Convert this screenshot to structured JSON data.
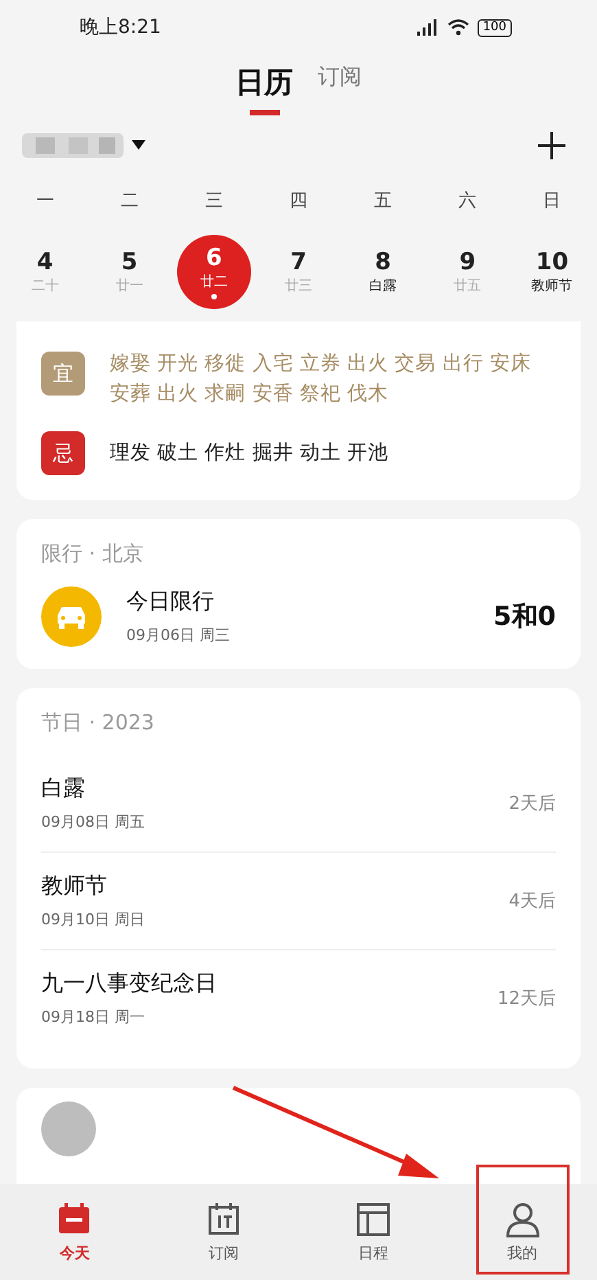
{
  "status_bar": {
    "time": "晚上8:21",
    "battery": "100"
  },
  "tabs": [
    {
      "label": "日历",
      "selected": true
    },
    {
      "label": "订阅",
      "selected": false
    }
  ],
  "weekdays": [
    "一",
    "二",
    "三",
    "四",
    "五",
    "六",
    "日"
  ],
  "dates": [
    {
      "day": "4",
      "sub": "二十",
      "selected": false,
      "festival": false
    },
    {
      "day": "5",
      "sub": "廿一",
      "selected": false,
      "festival": false
    },
    {
      "day": "6",
      "sub": "廿二",
      "selected": true,
      "festival": false
    },
    {
      "day": "7",
      "sub": "廿三",
      "selected": false,
      "festival": false
    },
    {
      "day": "8",
      "sub": "白露",
      "selected": false,
      "festival": true
    },
    {
      "day": "9",
      "sub": "廿五",
      "selected": false,
      "festival": false
    },
    {
      "day": "10",
      "sub": "教师节",
      "selected": false,
      "festival": true
    }
  ],
  "almanac": [
    {
      "kind": "good",
      "badge": "宜",
      "lines": [
        "嫁娶 开光 移徙 入宅 立券 出火 交易 出行 安床",
        "安葬 出火 求嗣 安香 祭祀 伐木"
      ]
    },
    {
      "kind": "bad",
      "badge": "忌",
      "lines": [
        "理发 破土 作灶 掘井 动土 开池"
      ]
    }
  ],
  "traffic": {
    "title": "限行 · 北京",
    "label": "今日限行",
    "date": "09月06日 周三",
    "numbers": "5和0"
  },
  "holidays": {
    "title": "节日 · 2023",
    "items": [
      {
        "name": "白露",
        "date": "09月08日 周五",
        "remaining": "2天后"
      },
      {
        "name": "教师节",
        "date": "09月10日 周日",
        "remaining": "4天后"
      },
      {
        "name": "九一八事变纪念日",
        "date": "09月18日 周一",
        "remaining": "12天后"
      }
    ]
  },
  "nav": [
    {
      "label": "今天",
      "selected": true,
      "kind": "today"
    },
    {
      "label": "订阅",
      "selected": false,
      "kind": "subscribe"
    },
    {
      "label": "日程",
      "selected": false,
      "kind": "schedule"
    },
    {
      "label": "我的",
      "selected": false,
      "kind": "me"
    }
  ]
}
